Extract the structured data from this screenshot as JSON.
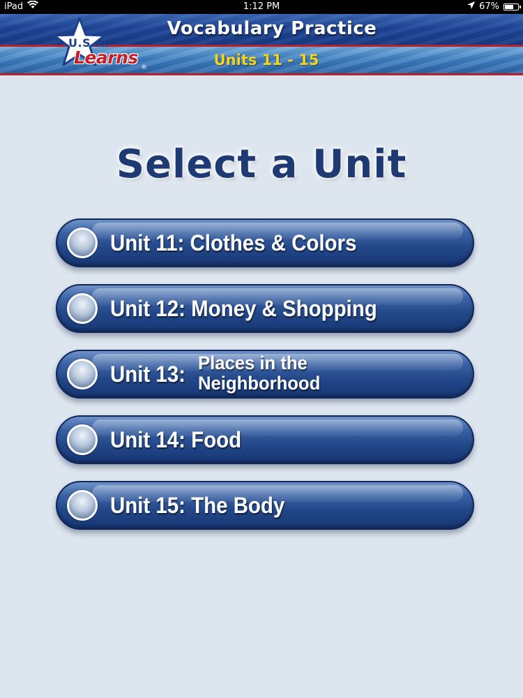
{
  "status_bar": {
    "device": "iPad",
    "time": "1:12 PM",
    "battery": "67%",
    "battery_level": 0.67
  },
  "header": {
    "title": "Vocabulary Practice",
    "subtitle": "Units 11 - 15",
    "logo_line1": "U.S.A.",
    "logo_line2": "Learns",
    "logo_reg": "®"
  },
  "main": {
    "title": "Select a Unit",
    "units": [
      {
        "label": "Unit 11: Clothes & Colors"
      },
      {
        "label": "Unit 12: Money & Shopping"
      },
      {
        "prefix": "Unit 13:",
        "line1": "Places in the",
        "line2": "Neighborhood"
      },
      {
        "label": "Unit 14: Food"
      },
      {
        "label": "Unit 15: The Body"
      }
    ]
  },
  "colors": {
    "background": "#dde5ef",
    "title_text": "#1f3a73",
    "button_blue": "#23488a",
    "subtitle_yellow": "#f5d21c",
    "accent_red": "#b5202b"
  },
  "icons": {
    "wifi": "wifi-icon",
    "location": "location-arrow-icon",
    "battery": "battery-icon",
    "unit_bullet": "radio-circle-icon"
  }
}
